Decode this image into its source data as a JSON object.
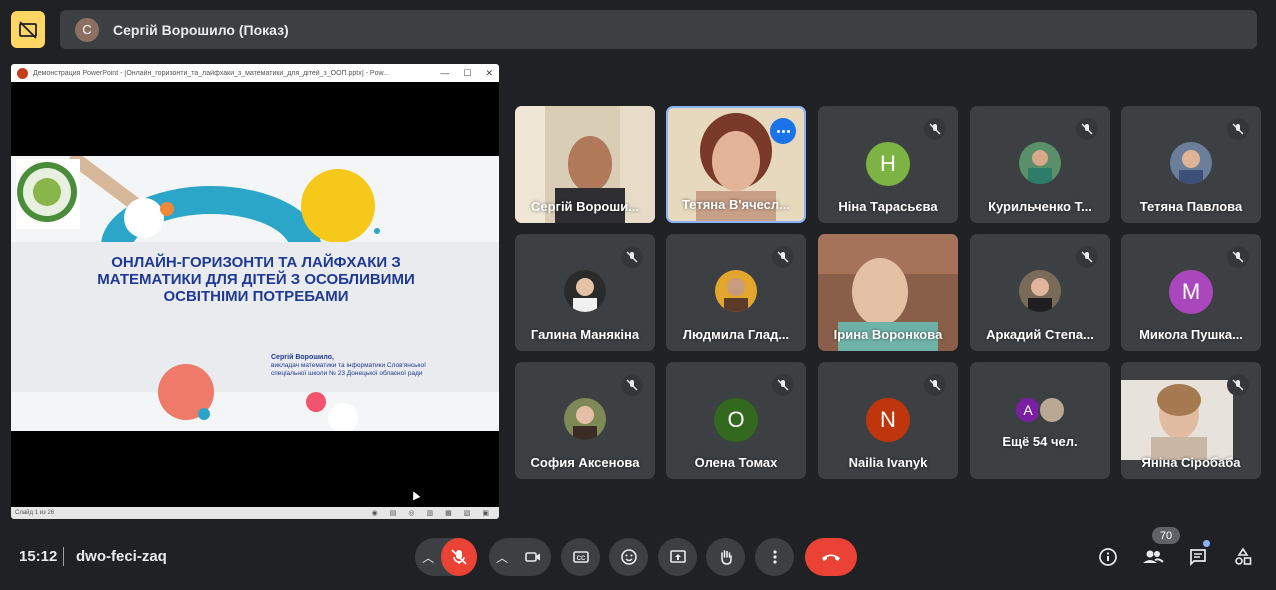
{
  "presenter": {
    "initial": "С",
    "name": "Сергій Ворошило (Показ)"
  },
  "ppt": {
    "window_title": "Демонстрация PowerPoint - [Онлайн_горизонти_та_лайфхаки_з_математики_для_дітей_з_ООП.pptx] - Pow...",
    "slide_title": "ОНЛАЙН-ГОРИЗОНТИ ТА ЛАЙФХАКИ З МАТЕМАТИКИ ДЛЯ ДІТЕЙ З ОСОБЛИВИМИ ОСВІТНІМИ ПОТРЕБАМИ",
    "author_name": "Сергій Ворошило,",
    "author_line1": "викладач математики та інформатики Слов'янської",
    "author_line2": "спеціальної школи № 23 Донецької обласної ради",
    "status": "Слайд 1 из 26"
  },
  "tiles": [
    {
      "name": "Сергій Вороши..."
    },
    {
      "name": "Тетяна В'ячесл..."
    },
    {
      "name": "Ніна Тарасьєва",
      "initial": "Н",
      "color": "#7cb342"
    },
    {
      "name": "Курильченко Т..."
    },
    {
      "name": "Тетяна Павлова"
    },
    {
      "name": "Галина Манякіна"
    },
    {
      "name": "Людмила Глад..."
    },
    {
      "name": "Ірина Воронкова"
    },
    {
      "name": "Аркадий Степа..."
    },
    {
      "name": "Микола Пушка...",
      "initial": "М",
      "color": "#ab47bc"
    },
    {
      "name": "София Аксенова"
    },
    {
      "name": "Олена Томах",
      "initial": "О",
      "color": "#33691e"
    },
    {
      "name": "Nailia Ivanyk",
      "initial": "N",
      "color": "#bf360c"
    },
    {
      "name": "Ещё 54 чел.",
      "initial": "A",
      "color": "#7b1fa2"
    },
    {
      "name": "Яніна Сіробаба"
    }
  ],
  "bottom": {
    "time": "15:12",
    "meeting_code": "dwo-feci-zaq",
    "participants_count": "70"
  },
  "colors": {
    "accent": "#8ab4f8",
    "end_call": "#ea4335",
    "mic_off": "#ea4335",
    "present_btn": "#fdd663"
  }
}
